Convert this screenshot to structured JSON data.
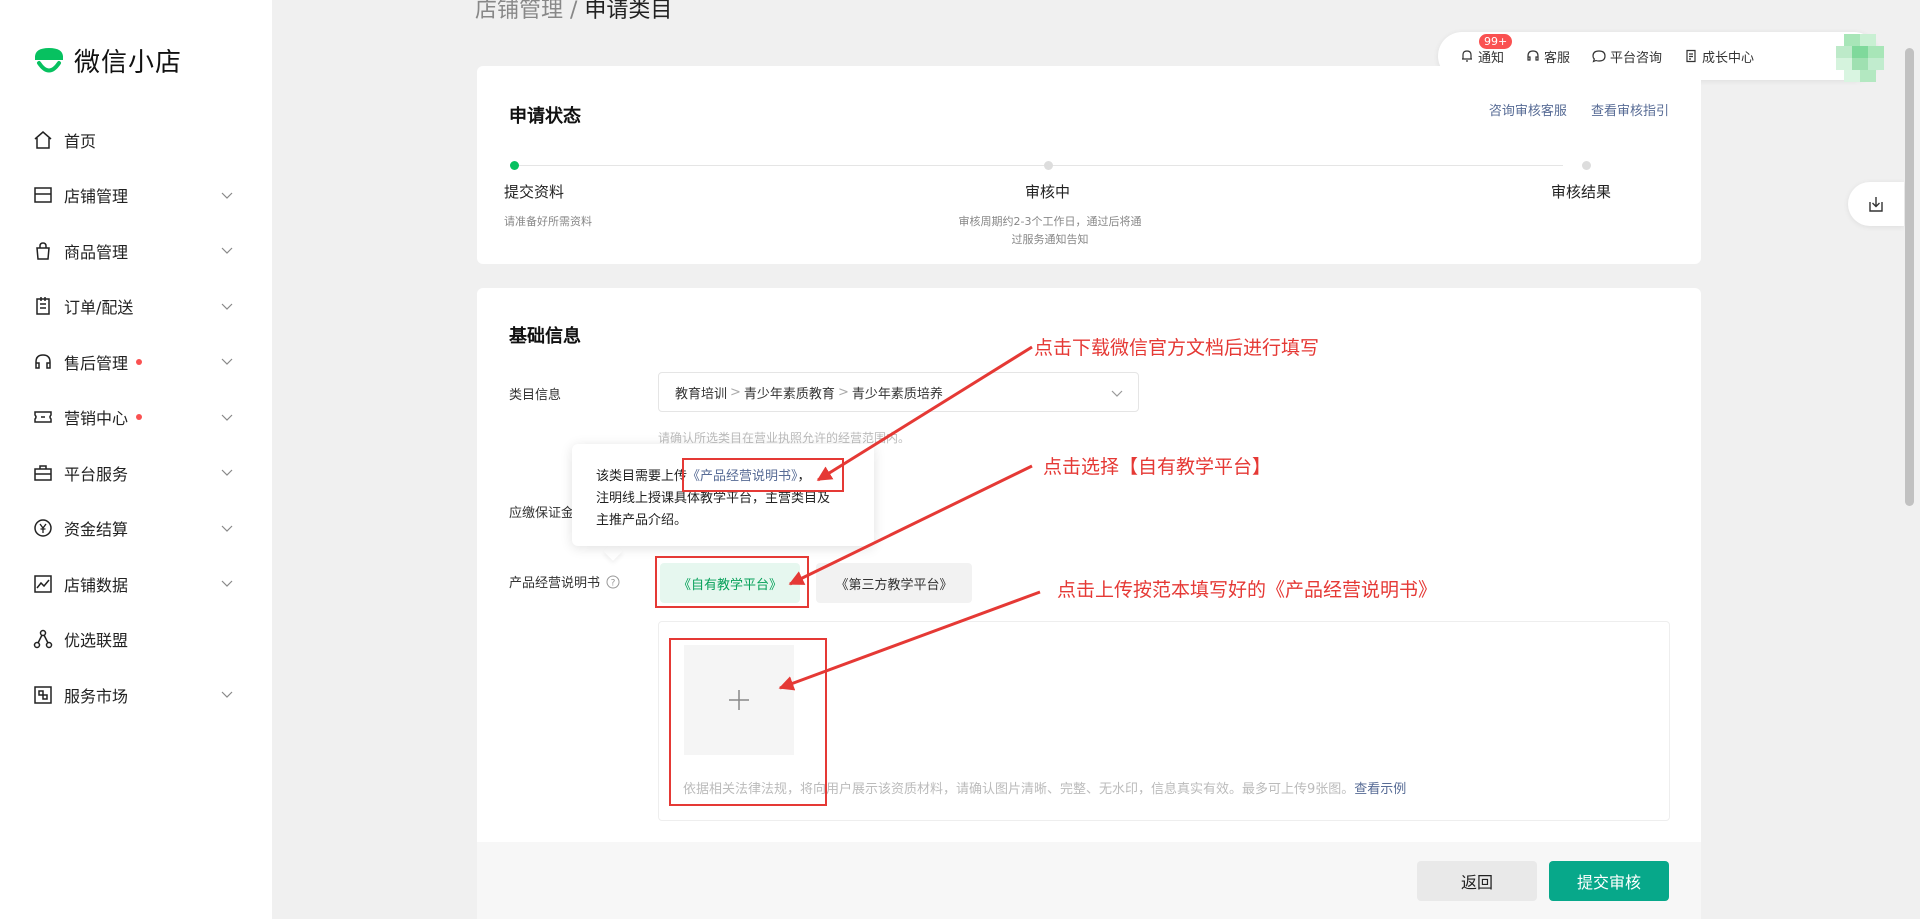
{
  "app": {
    "logo_text": "微信小店"
  },
  "sidebar": {
    "items": [
      {
        "label": "首页",
        "icon": "home-icon",
        "chevron": false,
        "dot": false
      },
      {
        "label": "店铺管理",
        "icon": "store-icon",
        "chevron": true,
        "dot": false
      },
      {
        "label": "商品管理",
        "icon": "bag-icon",
        "chevron": true,
        "dot": false
      },
      {
        "label": "订单/配送",
        "icon": "order-icon",
        "chevron": true,
        "dot": false
      },
      {
        "label": "售后管理",
        "icon": "headset-icon",
        "chevron": true,
        "dot": true
      },
      {
        "label": "营销中心",
        "icon": "ticket-icon",
        "chevron": true,
        "dot": true
      },
      {
        "label": "平台服务",
        "icon": "briefcase-icon",
        "chevron": true,
        "dot": false
      },
      {
        "label": "资金结算",
        "icon": "yen-icon",
        "chevron": true,
        "dot": false
      },
      {
        "label": "店铺数据",
        "icon": "chart-icon",
        "chevron": true,
        "dot": false
      },
      {
        "label": "优选联盟",
        "icon": "network-icon",
        "chevron": false,
        "dot": false
      },
      {
        "label": "服务市场",
        "icon": "market-icon",
        "chevron": true,
        "dot": false
      }
    ]
  },
  "breadcrumb": {
    "parent": "店铺管理 / ",
    "current": "申请类目"
  },
  "toolbar": {
    "notify": "通知",
    "notify_badge": "99+",
    "service": "客服",
    "consult": "平台咨询",
    "growth": "成长中心"
  },
  "status": {
    "title": "申请状态",
    "link_consult": "咨询审核客服",
    "link_guide": "查看审核指引",
    "steps": [
      {
        "label": "提交资料",
        "desc": "请准备好所需资料"
      },
      {
        "label": "审核中",
        "desc_line1": "审核周期约2-3个工作日，通过后将通",
        "desc_line2": "过服务通知告知"
      },
      {
        "label": "审核结果"
      }
    ]
  },
  "basic": {
    "title": "基础信息",
    "category_label": "类目信息",
    "category_path": [
      "教育培训",
      "青少年素质教育",
      "青少年素质培养"
    ],
    "category_hint": "请确认所选类目在营业执照允许的经营范围内。",
    "deposit_label": "应缴保证金",
    "product_doc_label": "产品经营说明书",
    "tooltip": {
      "prefix": "该类目需要上传",
      "link": "《产品经营说明书》",
      "suffix": "，",
      "line2": "注明线上授课具体教学平台，主营类目及",
      "line3": "主推产品介绍。"
    },
    "option_selected": "《自有教学平台》",
    "option_other": "《第三方教学平台》",
    "upload_hint": "依据相关法律法规，将向用户展示该资质材料，请确认图片清晰、完整、无水印，信息真实有效。最多可上传9张图。",
    "upload_example_link": "查看示例"
  },
  "footer": {
    "back": "返回",
    "submit": "提交审核"
  },
  "annotations": {
    "a1": "点击下载微信官方文档后进行填写",
    "a2": "点击选择【自有教学平台】",
    "a3": "点击上传按范本填写好的《产品经营说明书》"
  },
  "colors": {
    "brand_green": "#07c160",
    "submit_teal": "#07a88a",
    "link": "#576b95",
    "annotation_red": "#e53935"
  }
}
